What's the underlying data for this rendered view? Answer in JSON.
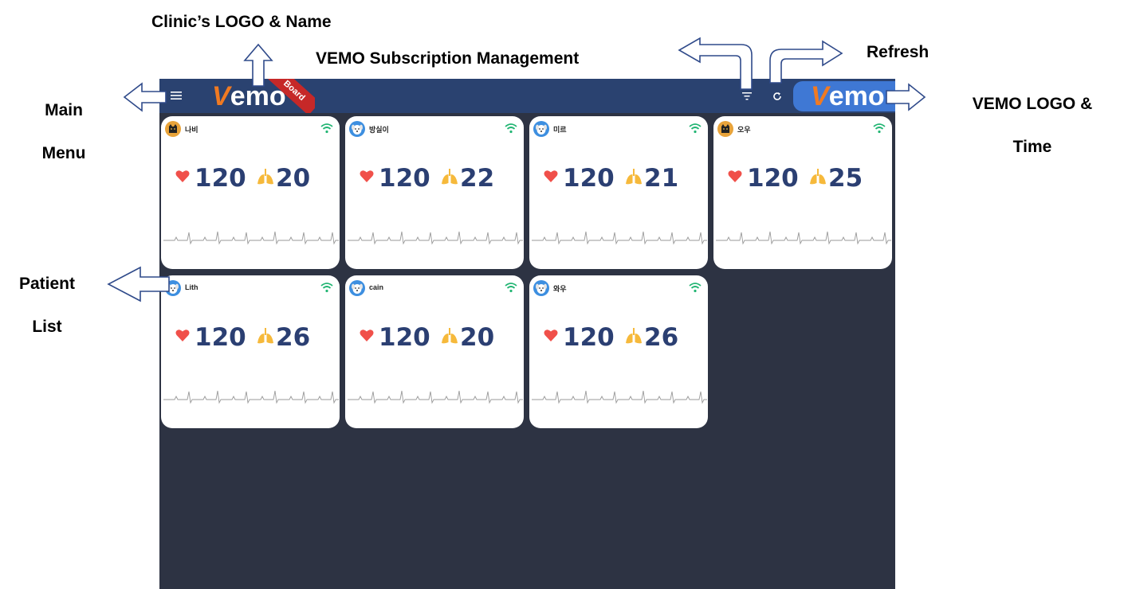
{
  "annotations": {
    "clinic_logo": "Clinic’s LOGO & Name",
    "subscription": "VEMO Subscription Management",
    "refresh": "Refresh",
    "main_menu_line1": "Main",
    "main_menu_line2": "Menu",
    "vemo_logo_line1": "VEMO LOGO &",
    "vemo_logo_line2": "Time",
    "patient_list_line1": "Patient",
    "patient_list_line2": "List"
  },
  "topbar": {
    "menu_icon": "hamburger-icon",
    "clinic_logo_v": "V",
    "clinic_logo_rest": "emo",
    "board_ribbon": "Board",
    "filter_icon": "filter-icon",
    "refresh_icon": "refresh-icon",
    "vemo_logo_v": "V",
    "vemo_logo_rest": "emo",
    "bar_color": "#2a4270",
    "accent_orange": "#f07a22"
  },
  "patients": [
    {
      "name": "나비",
      "heart_rate": "120",
      "resp_rate": "20",
      "avatar": "black-cat",
      "avatar_color": "#e8a33a"
    },
    {
      "name": "방실이",
      "heart_rate": "120",
      "resp_rate": "22",
      "avatar": "white-dog",
      "avatar_color": "#3d8fe0"
    },
    {
      "name": "미르",
      "heart_rate": "120",
      "resp_rate": "21",
      "avatar": "white-dog",
      "avatar_color": "#3d8fe0"
    },
    {
      "name": "오우",
      "heart_rate": "120",
      "resp_rate": "25",
      "avatar": "black-cat",
      "avatar_color": "#e8a33a"
    },
    {
      "name": "Lith",
      "heart_rate": "120",
      "resp_rate": "26",
      "avatar": "white-dog",
      "avatar_color": "#3d8fe0"
    },
    {
      "name": "cain",
      "heart_rate": "120",
      "resp_rate": "20",
      "avatar": "white-dog",
      "avatar_color": "#3d8fe0"
    },
    {
      "name": "와우",
      "heart_rate": "120",
      "resp_rate": "26",
      "avatar": "white-dog",
      "avatar_color": "#3d8fe0"
    }
  ],
  "colors": {
    "heart": "#f0504a",
    "lung": "#f6b93b",
    "vital_text": "#2b3f72",
    "wifi": "#22b573",
    "background": "#2d3343"
  }
}
